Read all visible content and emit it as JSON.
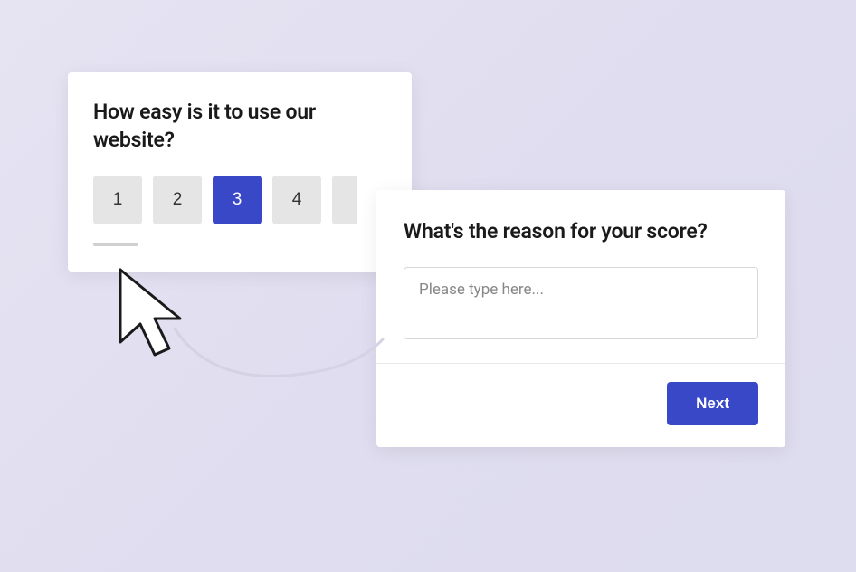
{
  "rating_card": {
    "question": "How easy is it to use our website?",
    "options": [
      "1",
      "2",
      "3",
      "4"
    ],
    "selected_index": 2
  },
  "reason_card": {
    "question": "What's the reason for your score?",
    "placeholder": "Please type here...",
    "next_label": "Next"
  },
  "colors": {
    "accent": "#3848c6",
    "neutral_button": "#e5e5e5",
    "background": "#e2dff1"
  }
}
